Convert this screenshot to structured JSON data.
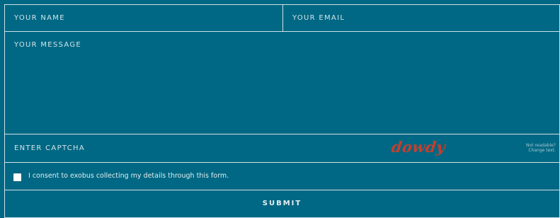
{
  "form": {
    "name_placeholder": "YOUR NAME",
    "email_placeholder": "YOUR EMAIL",
    "message_placeholder": "YOUR MESSAGE",
    "captcha_placeholder": "ENTER CAPTCHA",
    "captcha_text": "dowdy",
    "refresh_line1": "Not readable?",
    "refresh_line2": "Change text.",
    "consent_label": "I consent to exobus collecting my details through this form.",
    "consent_checked": false,
    "submit_label": "SUBMIT"
  },
  "colors": {
    "background": "#006884",
    "border": "#cfe1e8",
    "captcha": "#c53f2d"
  }
}
